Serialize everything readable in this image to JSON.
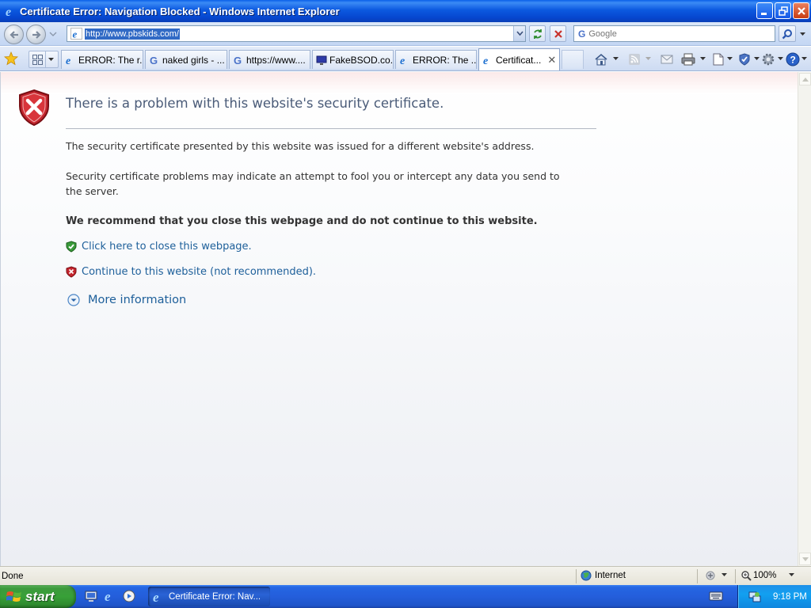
{
  "window": {
    "title": "Certificate Error: Navigation Blocked - Windows Internet Explorer"
  },
  "address_bar": {
    "url": "http://www.pbskids.com/",
    "search_placeholder": "Google",
    "search_engine_glyph": "G"
  },
  "tabs": [
    {
      "label": "ERROR: The r...",
      "icon": "ie-icon"
    },
    {
      "label": "naked girls - ...",
      "icon": "google-icon"
    },
    {
      "label": "https://www....",
      "icon": "google-icon"
    },
    {
      "label": "FakeBSOD.co...",
      "icon": "monitor-icon"
    },
    {
      "label": "ERROR: The ...",
      "icon": "ie-icon"
    },
    {
      "label": "Certificat...",
      "icon": "ie-icon",
      "active": true
    }
  ],
  "page": {
    "title": "There is a problem with this website's security certificate.",
    "para1": "The security certificate presented by this website was issued for a different website's address.",
    "para2": "Security certificate problems may indicate an attempt to fool you or intercept any data you send to the server.",
    "recommend": "We recommend that you close this webpage and do not continue to this website.",
    "close_link": "Click here to close this webpage.",
    "continue_link": "Continue to this website (not recommended).",
    "more_info": "More information"
  },
  "status_bar": {
    "status": "Done",
    "zone": "Internet",
    "zoom": "100%"
  },
  "taskbar": {
    "start_label": "start",
    "task_item": "Certificate Error: Nav...",
    "clock": "9:18 PM"
  },
  "colors": {
    "title_bar": "#0a5fe8",
    "link": "#1d5f9a",
    "error_red": "#c4262e",
    "start_green": "#38a038"
  }
}
